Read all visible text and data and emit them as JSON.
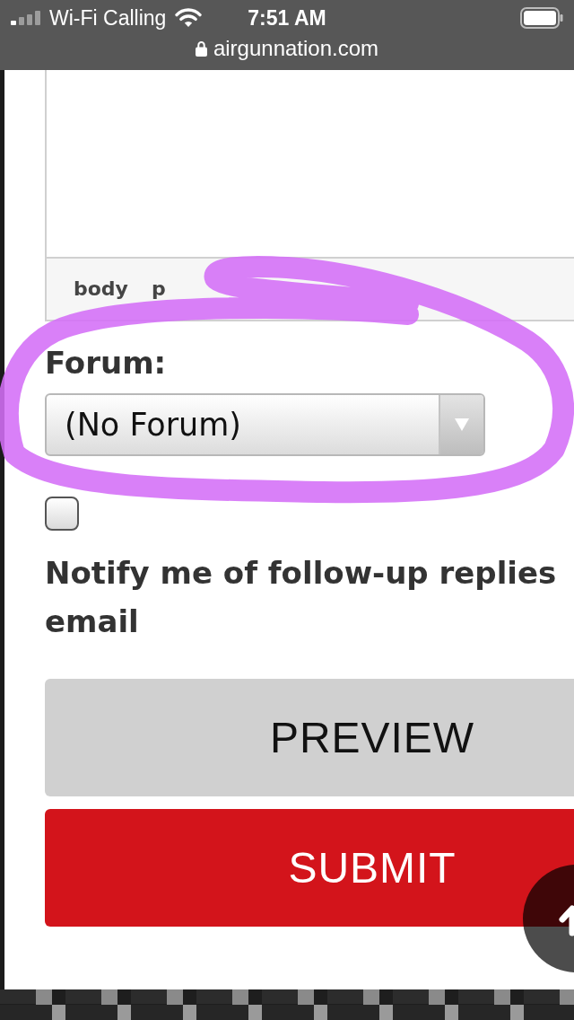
{
  "status_bar": {
    "carrier": "Wi-Fi Calling",
    "time": "7:51 AM",
    "url": "airgunnation.com"
  },
  "editor": {
    "path": [
      "body",
      "p"
    ]
  },
  "forum": {
    "label": "Forum:",
    "value": "(No Forum)"
  },
  "notify": {
    "checked": false,
    "label": "Notify me of follow-up replies email"
  },
  "buttons": [
    {
      "label": "PREVIEW",
      "kind": "secondary"
    },
    {
      "label": "SUBMIT",
      "kind": "primary"
    }
  ]
}
